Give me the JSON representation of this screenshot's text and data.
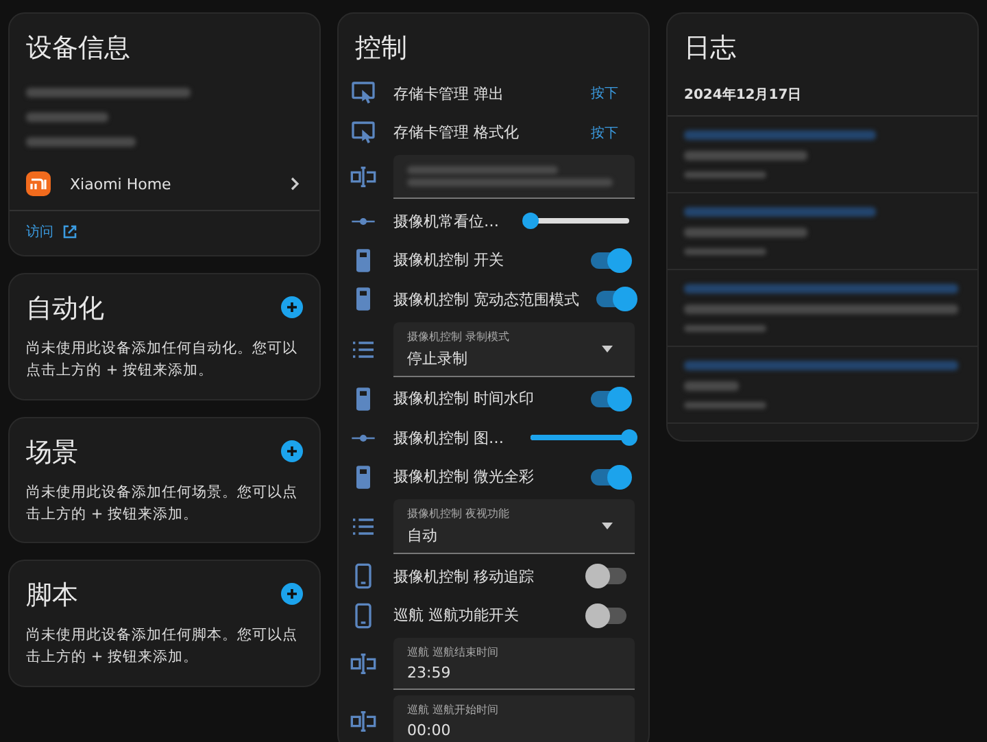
{
  "device_info": {
    "title": "设备信息",
    "integration": "Xiaomi Home",
    "link": "访问"
  },
  "sections": [
    {
      "title": "自动化",
      "text": "尚未使用此设备添加任何自动化。您可以点击上方的 + 按钮来添加。"
    },
    {
      "title": "场景",
      "text": "尚未使用此设备添加任何场景。您可以点击上方的 + 按钮来添加。"
    },
    {
      "title": "脚本",
      "text": "尚未使用此设备添加任何脚本。您可以点击上方的 + 按钮来添加。"
    }
  ],
  "controls": {
    "title": "控制",
    "rows": [
      {
        "kind": "button",
        "label": "存储卡管理 弹出",
        "action": "按下"
      },
      {
        "kind": "button",
        "label": "存储卡管理 格式化",
        "action": "按下"
      },
      {
        "kind": "text"
      },
      {
        "kind": "slider",
        "label": "摄像机常看位…",
        "level": 0.0
      },
      {
        "kind": "switch",
        "label": "摄像机控制 开关",
        "on": true
      },
      {
        "kind": "switch",
        "label": "摄像机控制 宽动态范围模式",
        "on": true
      },
      {
        "kind": "select",
        "label": "摄像机控制 录制模式",
        "value": "停止录制"
      },
      {
        "kind": "switch",
        "label": "摄像机控制 时间水印",
        "on": true
      },
      {
        "kind": "slider",
        "label": "摄像机控制 图…",
        "level": 1.0
      },
      {
        "kind": "switch",
        "label": "摄像机控制 微光全彩",
        "on": true
      },
      {
        "kind": "select",
        "label": "摄像机控制 夜视功能",
        "value": "自动"
      },
      {
        "kind": "switch",
        "label": "摄像机控制 移动追踪",
        "on": false
      },
      {
        "kind": "switch",
        "label": "巡航 巡航功能开关",
        "on": false
      },
      {
        "kind": "time",
        "label": "巡航 巡航结束时间",
        "value": "23:59"
      },
      {
        "kind": "time",
        "label": "巡航 巡航开始时间",
        "value": "00:00"
      }
    ]
  },
  "logbook": {
    "title": "日志",
    "date": "2024年12月17日"
  }
}
